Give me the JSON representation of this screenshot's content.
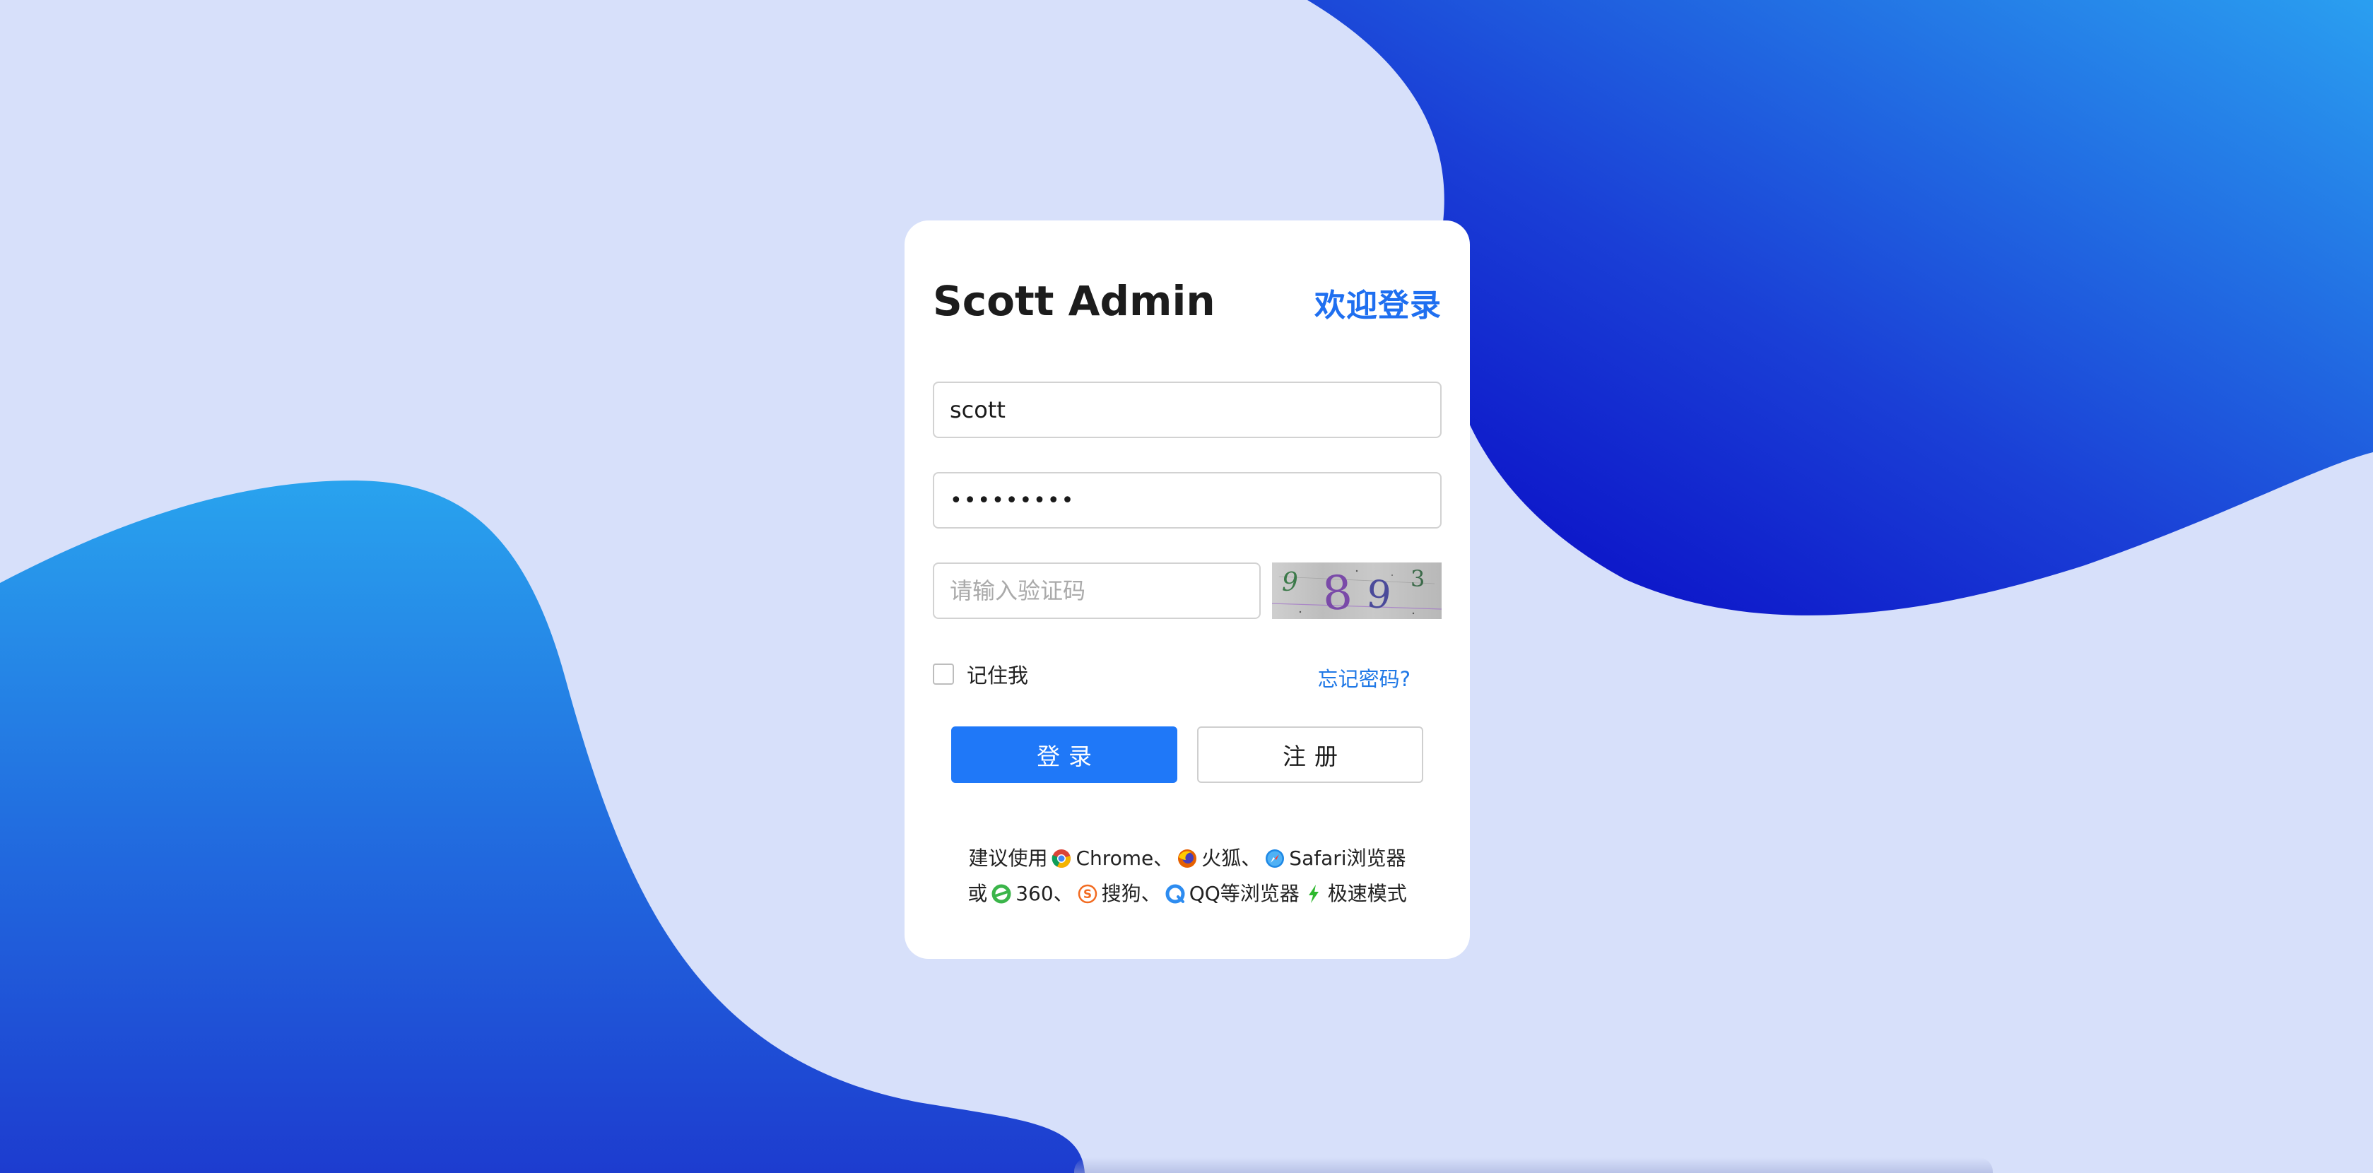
{
  "colors": {
    "background": "#d7e0fa",
    "accent": "#1f78f8",
    "welcome": "#1f6ff0",
    "link": "#1f78e6",
    "blob_dark": "#0a00c8",
    "blob_light": "#2596ec"
  },
  "header": {
    "brand": "Scott Admin",
    "welcome": "欢迎登录"
  },
  "form": {
    "username_value": "scott",
    "password_value": "•••••••••",
    "captcha_placeholder": "请输入验证码",
    "captcha_text": "9893",
    "remember_label": "记住我",
    "remember_checked": false,
    "forgot_label": "忘记密码?"
  },
  "buttons": {
    "login_label": "登录",
    "register_label": "注册"
  },
  "tips": {
    "line1_prefix": "建议使用",
    "chrome": "Chrome、",
    "firefox": "火狐、",
    "safari": "Safari浏览器",
    "line2_prefix": "或",
    "b360": "360、",
    "sogou": "搜狗、",
    "qq": "QQ等浏览器",
    "speed": "极速模式",
    "icons": [
      "chrome-icon",
      "firefox-icon",
      "safari-icon",
      "ie360-icon",
      "sogou-icon",
      "qq-browser-icon",
      "lightning-icon"
    ]
  }
}
